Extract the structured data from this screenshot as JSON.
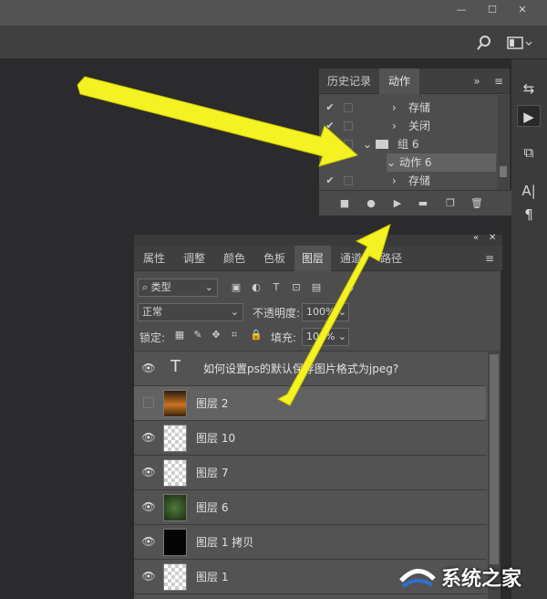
{
  "actions_panel": {
    "tabs": [
      {
        "label": "历史记录"
      },
      {
        "label": "动作"
      }
    ],
    "rows": [
      {
        "label": "存储",
        "indent": 2,
        "checked": true
      },
      {
        "label": "关闭",
        "indent": 2,
        "checked": true
      },
      {
        "label": "组 6",
        "indent": 1,
        "checked": true,
        "folder": true
      },
      {
        "label": "动作 6",
        "indent": 2,
        "checked": false,
        "selected": true
      },
      {
        "label": "存储",
        "indent": 3,
        "checked": true
      }
    ],
    "icons": [
      "stop-icon",
      "record-icon",
      "play-icon",
      "folder-icon",
      "new-action-icon",
      "trash-icon"
    ]
  },
  "layers_panel": {
    "tabs": [
      {
        "label": "属性"
      },
      {
        "label": "调整"
      },
      {
        "label": "颜色"
      },
      {
        "label": "色板"
      },
      {
        "label": "图层"
      },
      {
        "label": "通道"
      },
      {
        "label": "路径"
      }
    ],
    "filter_label": "类型",
    "blend_mode": "正常",
    "opacity_label": "不透明度:",
    "opacity_value": "100%",
    "lock_label": "锁定:",
    "fill_label": "填充:",
    "fill_value": "100%",
    "layers": [
      {
        "name": "如何设置ps的默认保存图片格式为jpeg?",
        "visible": true,
        "type": "text"
      },
      {
        "name": "图层 2",
        "visible": false,
        "type": "photo",
        "selected": true
      },
      {
        "name": "图层 10",
        "visible": true,
        "type": "transparent"
      },
      {
        "name": "图层 7",
        "visible": true,
        "type": "transparent"
      },
      {
        "name": "图层 6",
        "visible": true,
        "type": "green"
      },
      {
        "name": "图层 1 拷贝",
        "visible": true,
        "type": "black"
      },
      {
        "name": "图层 1",
        "visible": true,
        "type": "transparent"
      }
    ]
  },
  "watermark": {
    "text": "系统之家"
  },
  "colors": {
    "arrow": "#f5f223",
    "panel": "#535353",
    "dark": "#2b2a2d"
  }
}
